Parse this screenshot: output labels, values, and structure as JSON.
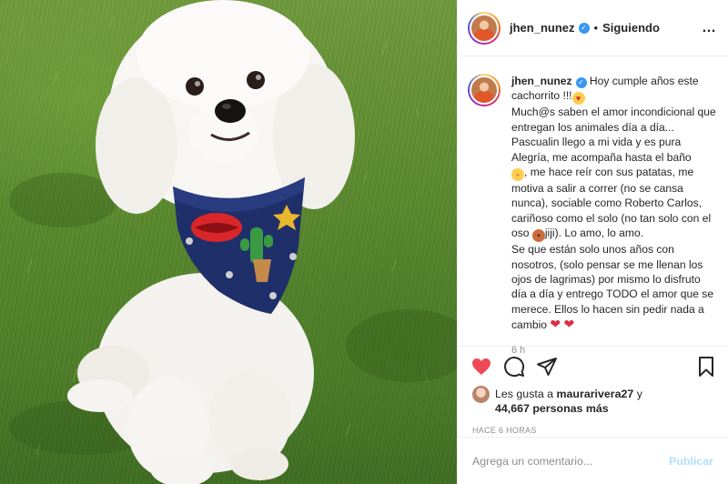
{
  "post": {
    "username": "jhen_nunez",
    "separator": "•",
    "follow_status": "Siguiendo",
    "more_icon": "…",
    "verified_icon": "✓"
  },
  "caption": {
    "username": "jhen_nunez",
    "line1": " Hoy cumple años este cachorrito !!!",
    "line2": "Much@s saben el amor incondicional que entregan los animales día a día...",
    "line3": "Pascualin llego a mi vida y es pura Alegría, me acompaña hasta el baño",
    "line4": ", me hace reír con sus patatas, me motiva a salir a correr (no se cansa nunca), sociable como Roberto Carlos, cariñoso como el solo (no tan solo con el oso ",
    "line5": "jiji). Lo amo, lo amo.",
    "line6": "Se que están solo unos años con nosotros, (solo pensar se me llenan los ojos de lagrimas) por mismo lo disfruto día a día y entrego TODO el amor que se merece. Ellos lo hacen sin pedir nada a cambio ",
    "time": "6 h"
  },
  "likes": {
    "prefix": "Les gusta a ",
    "user": "maurarivera27",
    "connector": " y",
    "others": "44,667 personas más"
  },
  "timestamp": "HACE 6 HORAS",
  "comment": {
    "placeholder": "Agrega un comentario...",
    "publish_label": "Publicar"
  },
  "icons": {
    "like": "heart-icon",
    "comment": "comment-icon",
    "share": "send-icon",
    "save": "bookmark-icon"
  },
  "colors": {
    "like_active": "#ed4956",
    "verified": "#3897f0",
    "publish_disabled": "#b2dffc"
  }
}
